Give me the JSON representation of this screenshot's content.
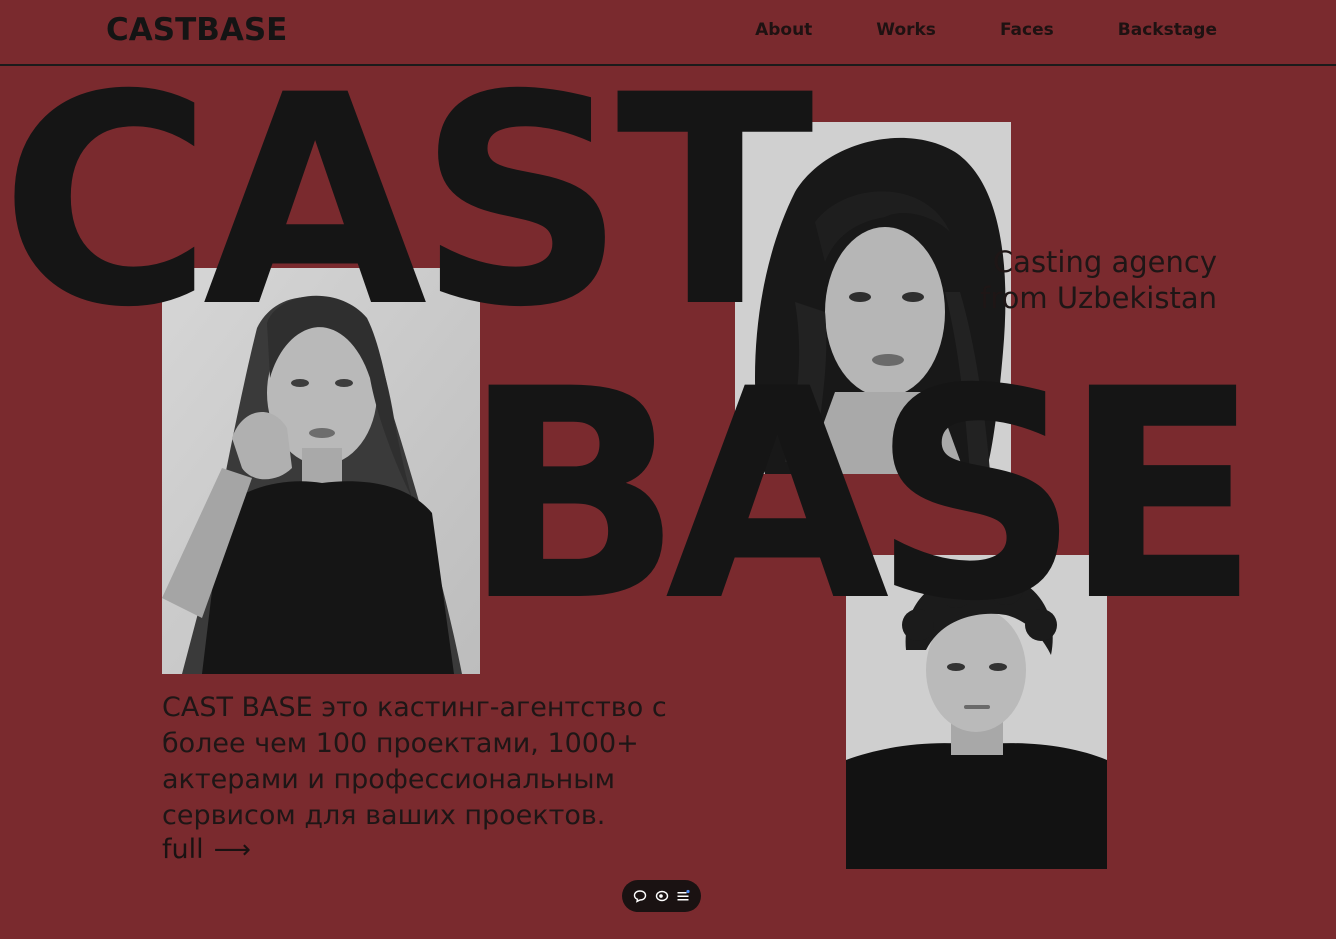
{
  "header": {
    "logo": "CASTBASE",
    "nav": [
      {
        "label": "About"
      },
      {
        "label": "Works"
      },
      {
        "label": "Faces"
      },
      {
        "label": "Backstage"
      }
    ]
  },
  "hero": {
    "word_top": "CAST",
    "word_bottom": "BASE",
    "tagline": "Casting agency from Uzbekistan",
    "description": "CAST BASE это кастинг-агентство с более чем 100 проектами, 1000+ актерами и профессиональным сервисом для ваших проектов.",
    "more_label": "full",
    "more_arrow": "⟶"
  },
  "photos": [
    {
      "name": "young woman with long wavy hair, hand under chin"
    },
    {
      "name": "woman with dark curly hair, close-up portrait"
    },
    {
      "name": "young man with curly hair, black t-shirt"
    }
  ],
  "widget": {
    "icons": [
      "chat-icon",
      "eye-icon",
      "menu-icon"
    ]
  },
  "colors": {
    "background": "#7a2a2e",
    "text": "#141414",
    "widget": "#1a1212"
  }
}
